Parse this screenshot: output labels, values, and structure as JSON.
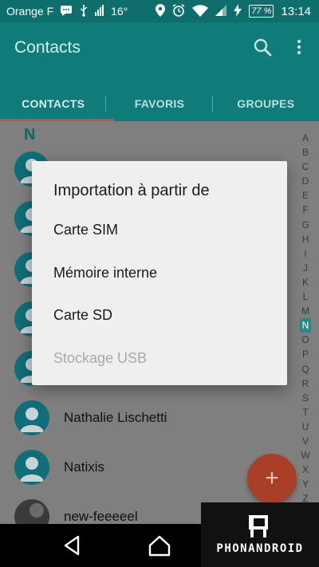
{
  "status_bar": {
    "carrier": "Orange F",
    "temperature": "16°",
    "battery": "77 %",
    "time": "13:14",
    "icons": [
      "message-icon",
      "usb-icon",
      "location-icon",
      "alarm-icon",
      "wifi-icon",
      "signal-icon",
      "charging-icon"
    ]
  },
  "app_bar": {
    "title": "Contacts",
    "icons": [
      "search-icon",
      "more-vert-icon"
    ]
  },
  "tabs": [
    {
      "label": "CONTACTS",
      "selected": true
    },
    {
      "label": "FAVORIS",
      "selected": false
    },
    {
      "label": "GROUPES",
      "selected": false
    }
  ],
  "list": {
    "section_letter": "N",
    "contacts": [
      {
        "name": "Nathalie Lischetti"
      },
      {
        "name": "Natixis"
      },
      {
        "name": "new-feeeeel"
      }
    ]
  },
  "alphabet_index": {
    "letters": [
      "A",
      "B",
      "C",
      "D",
      "E",
      "F",
      "G",
      "H",
      "I",
      "J",
      "K",
      "L",
      "M",
      "N",
      "O",
      "P",
      "Q",
      "R",
      "S",
      "T",
      "U",
      "V",
      "W",
      "X",
      "Y",
      "Z"
    ],
    "highlighted": "N"
  },
  "fab": {
    "icon": "add-icon",
    "label": "+"
  },
  "dialog": {
    "title": "Importation à partir de",
    "options": [
      {
        "label": "Carte SIM",
        "enabled": true
      },
      {
        "label": "Mémoire interne",
        "enabled": true
      },
      {
        "label": "Carte SD",
        "enabled": true
      },
      {
        "label": "Stockage USB",
        "enabled": false
      }
    ]
  },
  "nav_bar": {
    "icons": [
      "back-icon",
      "home-icon"
    ]
  },
  "watermark": {
    "text": "PHONANDROID"
  },
  "colors": {
    "app_bar": "#0f7c79",
    "status_bar": "#0e6e6c",
    "tab_indicator": "#c75335",
    "fab": "#a83f26",
    "dialog_bg": "#efefef",
    "disabled_text": "#a9a9a9"
  }
}
